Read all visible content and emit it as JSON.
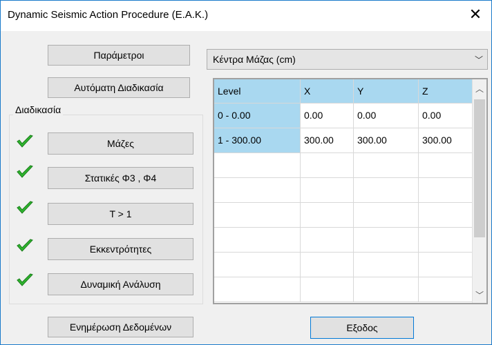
{
  "window": {
    "title": "Dynamic Seismic Action Procedure (E.A.K.)"
  },
  "buttons": {
    "parameters": "Παράμετροι",
    "automatic": "Αυτόματη Διαδικασία",
    "masses": "Μάζες",
    "statics": "Στατικές Φ3 , Φ4",
    "t_gt_1": "T > 1",
    "eccentricities": "Εκκεντρότητες",
    "dynamic": "Δυναμική Ανάλυση",
    "update": "Ενημέρωση Δεδομένων",
    "exit": "Εξοδος"
  },
  "group": {
    "label": "Διαδικασία"
  },
  "combo": {
    "value": "Κέντρα Μάζας (cm)"
  },
  "grid": {
    "columns": [
      "Level",
      "X",
      "Y",
      "Z"
    ],
    "rows": [
      [
        "0 - 0.00",
        "0.00",
        "0.00",
        "0.00"
      ],
      [
        "1 - 300.00",
        "300.00",
        "300.00",
        "300.00"
      ]
    ]
  },
  "colors": {
    "header": "#a9d8f0",
    "check": "#2fb52f",
    "accent": "#1979ca"
  }
}
